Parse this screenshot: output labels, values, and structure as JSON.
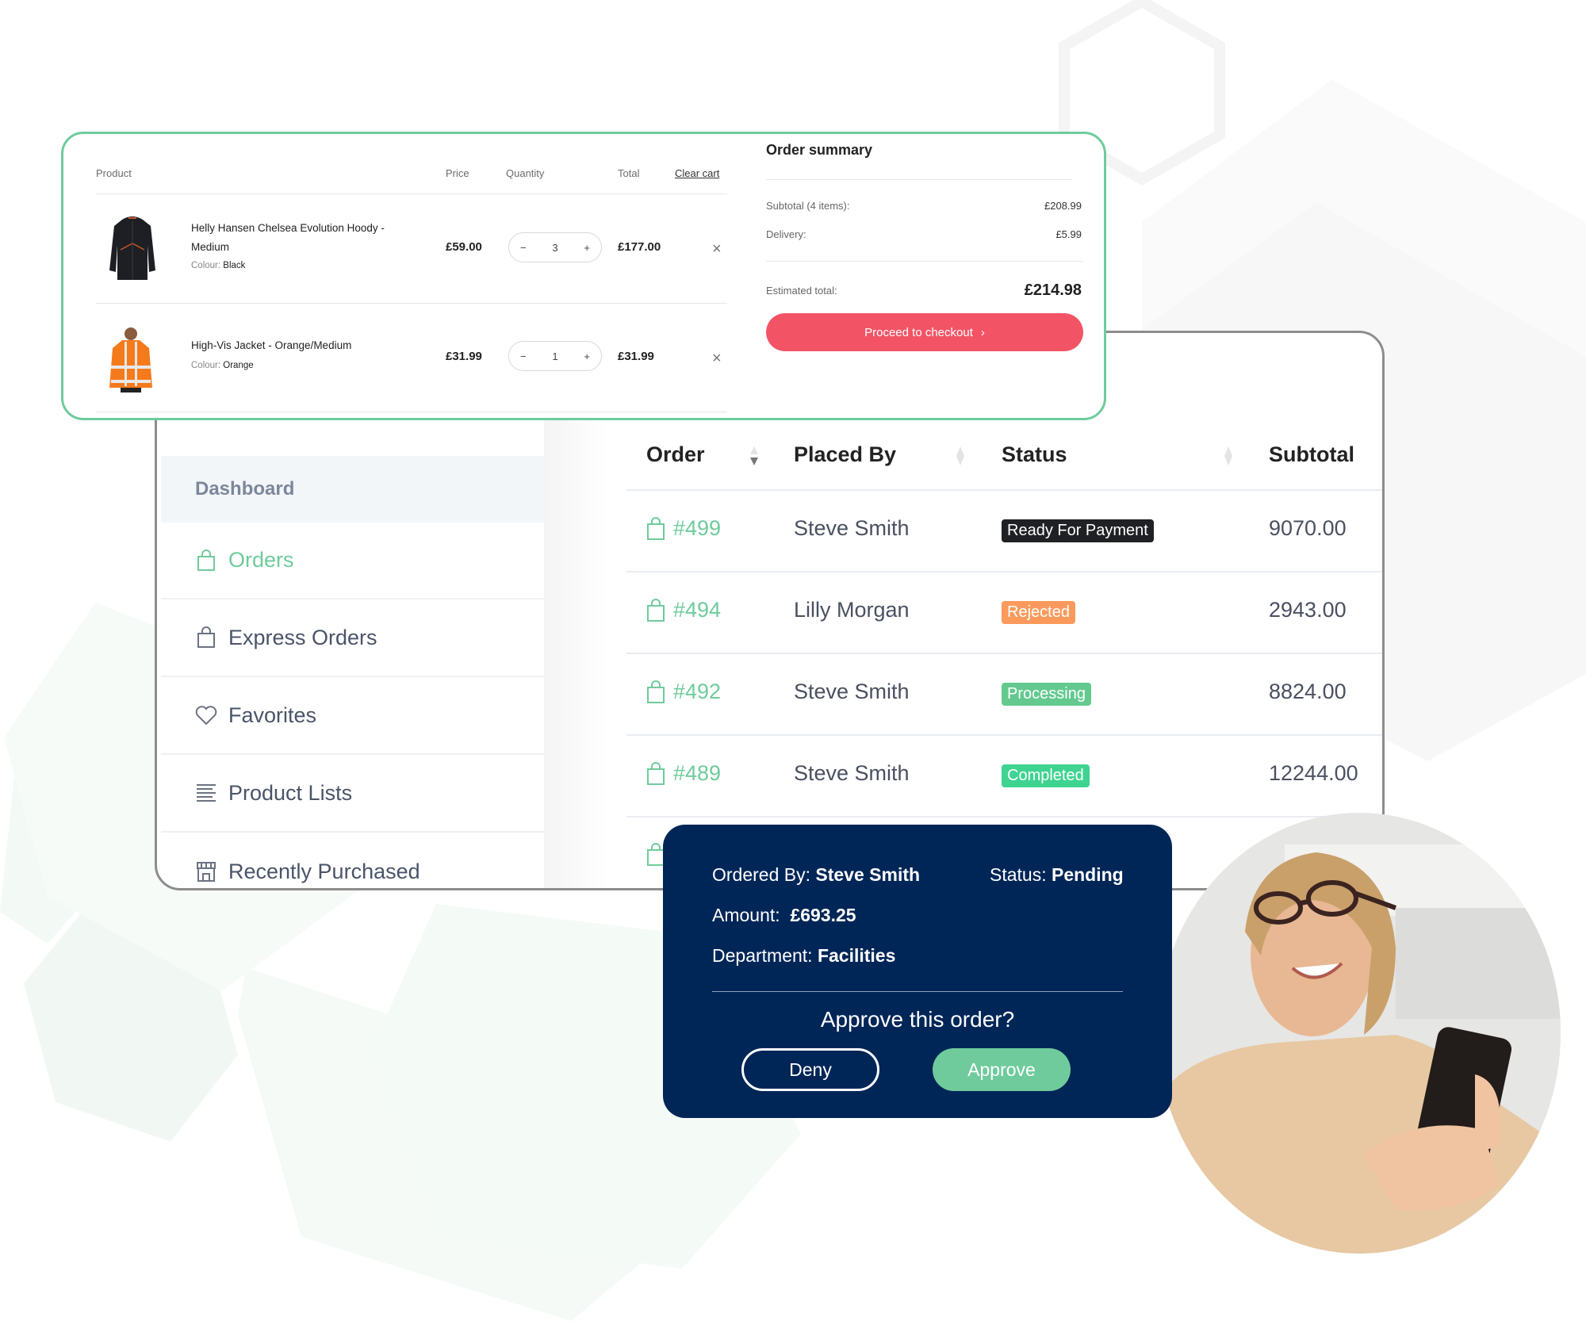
{
  "cart": {
    "headers": {
      "product": "Product",
      "price": "Price",
      "quantity": "Quantity",
      "total": "Total",
      "clear_cart": "Clear cart"
    },
    "items": [
      {
        "name_line1": "Helly Hansen Chelsea Evolution Hoody -",
        "name_line2": "Medium",
        "colour_label": "Colour:",
        "colour": "Black",
        "price": "£59.00",
        "quantity": "3",
        "total": "£177.00",
        "image": "black-hoody"
      },
      {
        "name_line1": "High-Vis Jacket - Orange/Medium",
        "name_line2": "",
        "colour_label": "Colour:",
        "colour": "Orange",
        "price": "£31.99",
        "quantity": "1",
        "total": "£31.99",
        "image": "orange-hi-vis-jacket"
      }
    ],
    "qty_minus": "−",
    "qty_plus": "+",
    "remove_icon": "×"
  },
  "summary": {
    "title": "Order summary",
    "subtotal_label": "Subtotal (4 items):",
    "subtotal_value": "£208.99",
    "delivery_label": "Delivery:",
    "delivery_value": "£5.99",
    "estimated_label": "Estimated total:",
    "estimated_value": "£214.98",
    "checkout_label": "Proceed to checkout",
    "checkout_icon": "›",
    "accent": "#f25466"
  },
  "sidebar": {
    "items": [
      {
        "label": "Dashboard",
        "icon": "none",
        "active": false
      },
      {
        "label": "Orders",
        "icon": "shopping-bag-icon",
        "active": true
      },
      {
        "label": "Express Orders",
        "icon": "shopping-bag-icon",
        "active": false
      },
      {
        "label": "Favorites",
        "icon": "heart-icon",
        "active": false
      },
      {
        "label": "Product Lists",
        "icon": "list-icon",
        "active": false
      },
      {
        "label": "Recently Purchased",
        "icon": "store-icon",
        "active": false
      }
    ],
    "accent": "#6fcb9c"
  },
  "orders_table": {
    "columns": [
      "Order",
      "Placed By",
      "Status",
      "Subtotal"
    ],
    "rows": [
      {
        "order": "#499",
        "placed_by": "Steve Smith",
        "status": "Ready For Payment",
        "status_color": "#1f2124",
        "subtotal": "9070.00"
      },
      {
        "order": "#494",
        "placed_by": "Lilly Morgan",
        "status": "Rejected",
        "status_color": "#fb9a5c",
        "subtotal": "2943.00"
      },
      {
        "order": "#492",
        "placed_by": "Steve Smith",
        "status": "Processing",
        "status_color": "#63c98f",
        "subtotal": "8824.00"
      },
      {
        "order": "#489",
        "placed_by": "Steve Smith",
        "status": "Completed",
        "status_color": "#3fd391",
        "subtotal": "12244.00"
      }
    ]
  },
  "approval": {
    "ordered_by_label": "Ordered By:",
    "ordered_by": "Steve Smith",
    "status_label": "Status:",
    "status": "Pending",
    "amount_label": "Amount:",
    "amount": "£693.25",
    "department_label": "Department:",
    "department": "Facilities",
    "question": "Approve this order?",
    "deny_label": "Deny",
    "approve_label": "Approve",
    "background": "#002657",
    "approve_color": "#6fcb9c"
  },
  "photo": {
    "subject": "smiling woman with glasses holding a smartphone"
  }
}
